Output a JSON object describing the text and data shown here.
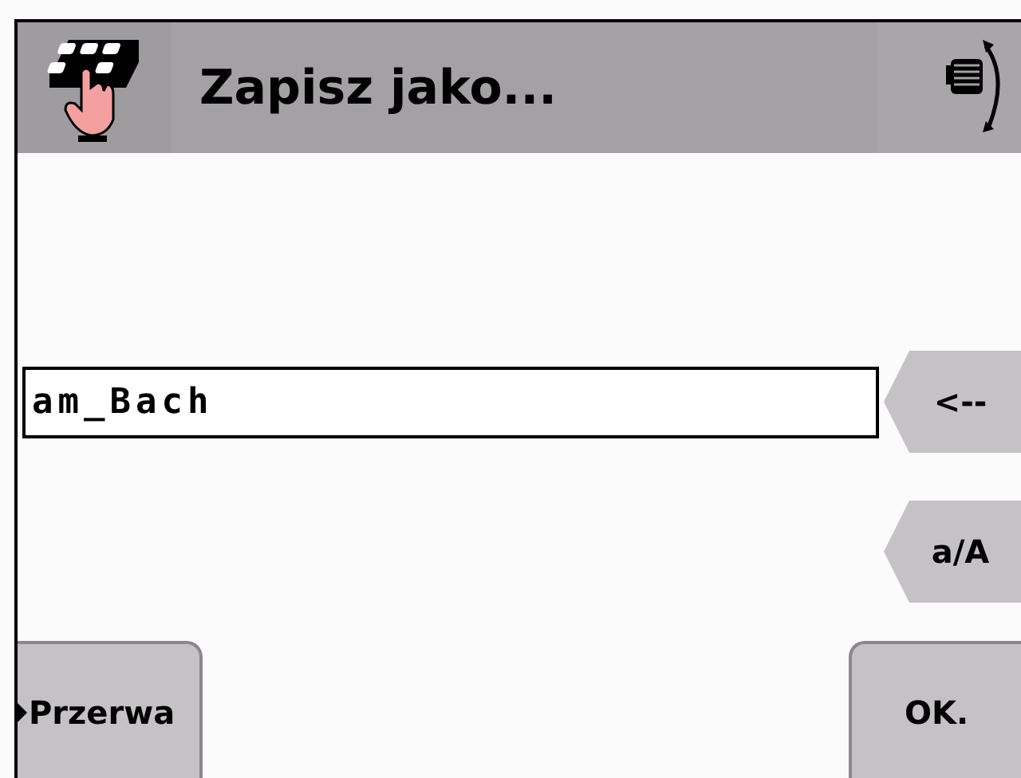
{
  "window": {
    "title": "Zapisz jako..."
  },
  "name_field": {
    "value": "am_Bach"
  },
  "side_buttons": [
    {
      "label": "<--"
    },
    {
      "label": "a/A"
    }
  ],
  "bottom_buttons": [
    {
      "label": "Przerwa",
      "kind": "left"
    },
    {
      "label": "OK.",
      "kind": "right"
    }
  ]
}
